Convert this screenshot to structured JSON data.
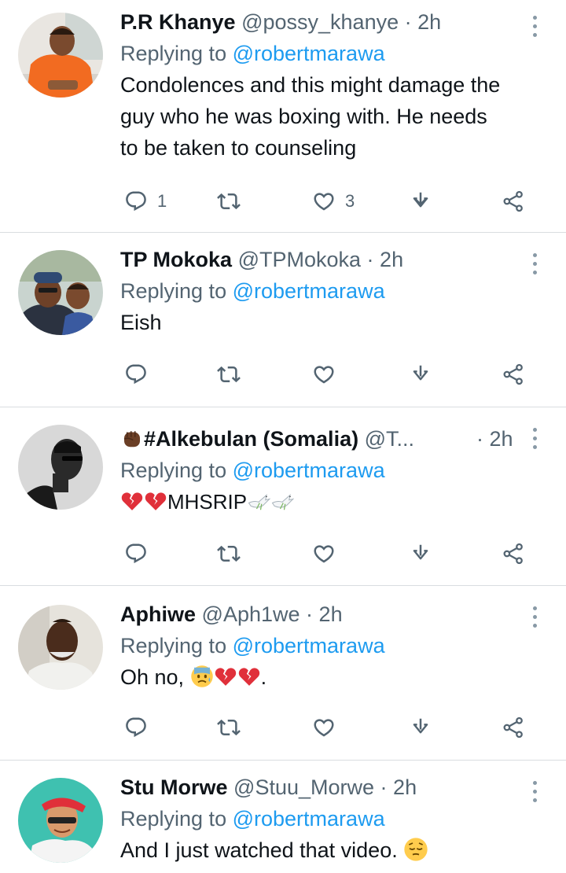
{
  "tweets": [
    {
      "name": "P.R Khanye",
      "handle": "@possy_khanye",
      "dot": "·",
      "time": "2h",
      "replying_prefix": "Replying to",
      "replying_to": "@robertmarawa",
      "text_lines": [
        "Condolences and this might damage the",
        "guy who he was boxing with. He needs",
        "to be taken to counseling"
      ],
      "reply_count": "1",
      "retweet_count": "",
      "like_count": "3"
    },
    {
      "name": "TP Mokoka",
      "handle": "@TPMokoka",
      "dot": "·",
      "time": "2h",
      "replying_prefix": "Replying to",
      "replying_to": "@robertmarawa",
      "text_lines": [
        "Eish"
      ],
      "reply_count": "",
      "retweet_count": "",
      "like_count": ""
    },
    {
      "name": "#Alkebulan (Somalia)",
      "name_emoji": "raised-fist-dark",
      "handle": "@T...",
      "dot": "·",
      "time": "2h",
      "replying_prefix": "Replying to",
      "replying_to": "@robertmarawa",
      "text": "MHSRIP",
      "text_emojis_before": [
        "broken-heart",
        "broken-heart"
      ],
      "text_emojis_after": [
        "dove",
        "dove"
      ],
      "reply_count": "",
      "retweet_count": "",
      "like_count": ""
    },
    {
      "name": "Aphiwe",
      "handle": "@Aph1we",
      "dot": "·",
      "time": "2h",
      "replying_prefix": "Replying to",
      "replying_to": "@robertmarawa",
      "text_start": "Oh no,",
      "text_end": ".",
      "text_emojis": [
        "anxious-face-sweat",
        "broken-heart",
        "broken-heart"
      ],
      "reply_count": "",
      "retweet_count": "",
      "like_count": ""
    },
    {
      "name": "Stu Morwe",
      "handle": "@Stuu_Morwe",
      "dot": "·",
      "time": "2h",
      "replying_prefix": "Replying to",
      "replying_to": "@robertmarawa",
      "text": "And I just watched that video.",
      "text_emoji_after": "pensive-face",
      "reply_count": "",
      "retweet_count": "",
      "like_count": ""
    }
  ],
  "colors": {
    "text": "#0f1419",
    "secondary": "#536471",
    "link": "#1d9bf0",
    "divider": "#d9dde0",
    "broken_heart": "#e0303a"
  },
  "icons": {
    "reply": "reply-icon",
    "retweet": "retweet-icon",
    "like": "heart-icon",
    "bookmark": "download-icon",
    "share": "share-icon",
    "more": "more-vertical-icon"
  }
}
